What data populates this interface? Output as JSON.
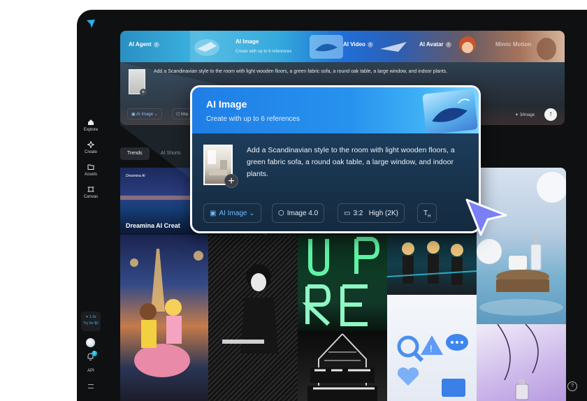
{
  "sidebar": {
    "items": [
      {
        "label": "Explore",
        "icon": "home-icon"
      },
      {
        "label": "Create",
        "icon": "sparkle-icon"
      },
      {
        "label": "Assets",
        "icon": "folder-icon"
      },
      {
        "label": "Canvas",
        "icon": "canvas-icon"
      }
    ],
    "promo_credits": "✦ 1.1k",
    "promo_cta": "Try for $0",
    "notification_count": "2",
    "api_label": "API"
  },
  "banner": {
    "tabs": [
      "AI Agent",
      "AI Image",
      "AI Video",
      "AI Avatar",
      "Mimic Motion"
    ],
    "subtitle": "Create with up to 6 references"
  },
  "prompt": {
    "text": "Add a Scandinavian style to the room with light wooden floors, a green fabric sofa, a round oak table, a large window, and indoor plants.",
    "chips": [
      "AI Image",
      "Ima"
    ],
    "cost": "✦ 3/image"
  },
  "feed": {
    "tabs": [
      "Trends",
      "AI Shorts"
    ],
    "featured_caption": "Dreamina AI Creat",
    "featured_brand": "Dreamina AI"
  },
  "card": {
    "title": "AI Image",
    "subtitle": "Create with up to 6 references",
    "prompt": "Add a Scandinavian style to the room with light wooden floors, a green fabric sofa, a round oak table, a large window, and indoor plants.",
    "mode": "AI Image",
    "model": "Image 4.0",
    "ratio": "3:2",
    "quality": "High (2K)"
  },
  "colors": {
    "accent": "#1f7ee6",
    "background": "#0f1012",
    "cursor": "#7b7ff5"
  }
}
